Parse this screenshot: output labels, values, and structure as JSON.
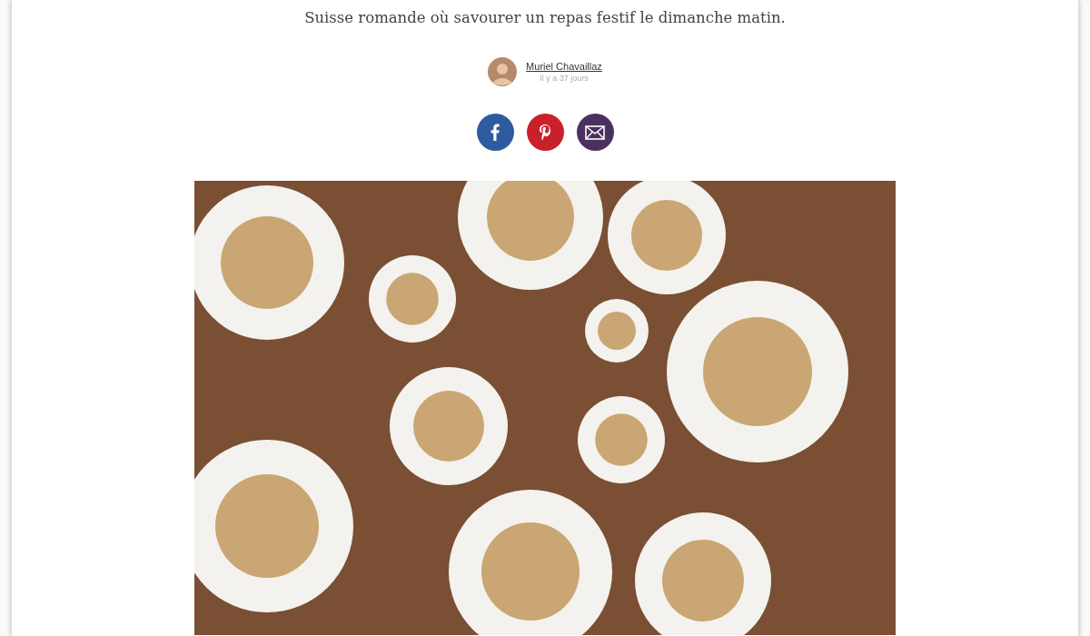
{
  "article": {
    "intro_line": "Suisse romande où savourer un repas festif le dimanche matin."
  },
  "author": {
    "name": "Muriel Chavaillaz",
    "date": "Il y a 37 jours"
  },
  "share_buttons": [
    {
      "kind": "facebook",
      "color": "#2d5b9e"
    },
    {
      "kind": "pinterest",
      "color": "#c9202c"
    },
    {
      "kind": "email",
      "color": "#4a3160"
    }
  ]
}
